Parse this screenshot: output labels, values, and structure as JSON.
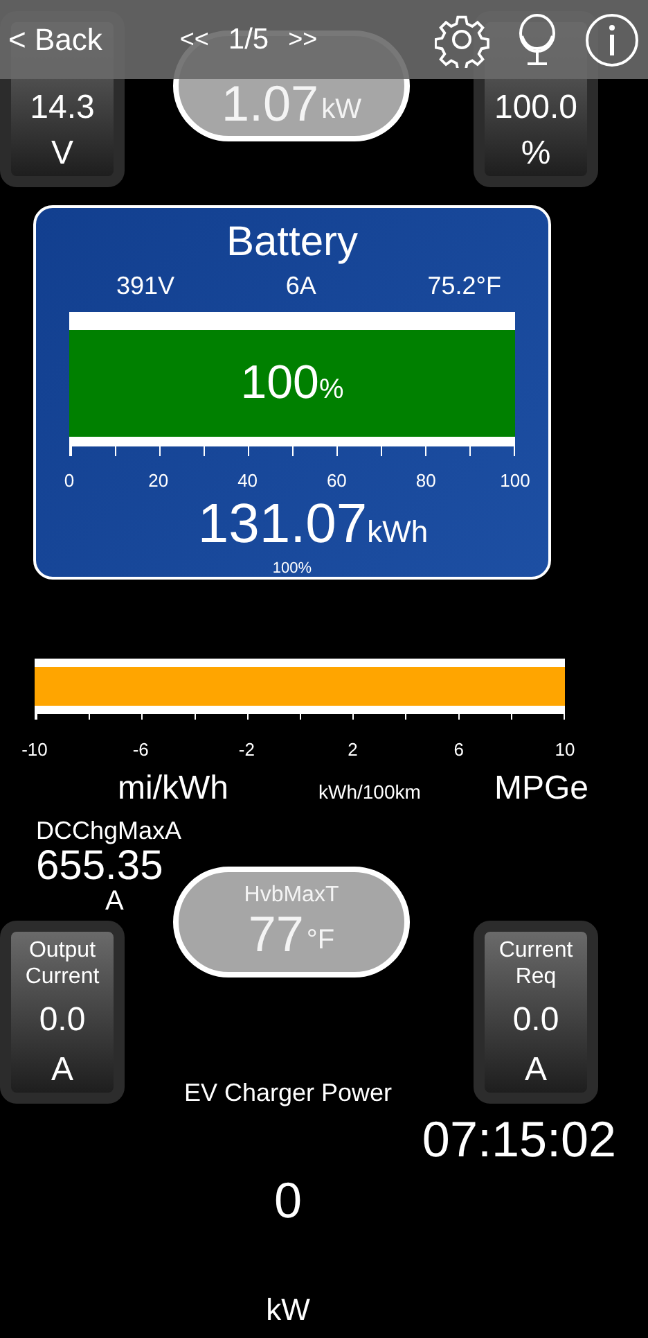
{
  "header": {
    "back": "< Back",
    "prev": "<<",
    "page": "1/5",
    "next": ">>"
  },
  "widgets": [
    {
      "kind": "tile",
      "value": "14.3",
      "unit": "V"
    },
    {
      "kind": "pill",
      "value": "1.07",
      "unit": "kW"
    },
    {
      "kind": "tile",
      "value": "100.0",
      "unit": "%"
    },
    {
      "kind": "plain",
      "label": "DCChgMaxA",
      "value": "655.35",
      "unit": "A"
    },
    {
      "kind": "pill",
      "label": "HvbMaxT",
      "value": "77",
      "unit": "°F"
    },
    {
      "kind": "tile",
      "label": "Output Current",
      "value": "0.0",
      "unit": "A"
    },
    {
      "kind": "tile",
      "label": "Current Req",
      "value": "0.0",
      "unit": "A"
    },
    {
      "kind": "center",
      "label": "EV Charger Power",
      "value": "0",
      "unit": "kW"
    },
    {
      "kind": "clock",
      "value": "07:15:02"
    }
  ],
  "battery": {
    "title": "Battery",
    "readings": [
      "391V",
      "6A",
      "75.2°F"
    ],
    "level": 1,
    "percent": "100",
    "percent_unit": "%",
    "ticks": [
      "0",
      "20",
      "40",
      "60",
      "80",
      "100"
    ],
    "energy": "131.07",
    "energy_unit": "kWh",
    "soc": "100%"
  },
  "efficiency": {
    "level": 1,
    "ticks": [
      "-10",
      "-6",
      "-2",
      "2",
      "6",
      "10"
    ],
    "units": [
      "mi/kWh",
      "kWh/100km",
      "MPGe"
    ]
  }
}
